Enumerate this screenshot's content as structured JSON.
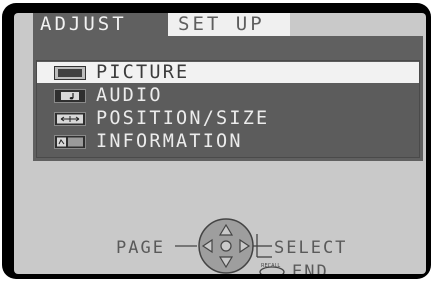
{
  "tabs": [
    {
      "label": "ADJUST",
      "active": true
    },
    {
      "label": "SET UP",
      "active": false
    }
  ],
  "menu": {
    "items": [
      {
        "label": "PICTURE",
        "icon": "picture-icon",
        "selected": true
      },
      {
        "label": "AUDIO",
        "icon": "audio-icon",
        "selected": false
      },
      {
        "label": "POSITION/SIZE",
        "icon": "position-size-icon",
        "selected": false
      },
      {
        "label": "INFORMATION",
        "icon": "information-icon",
        "selected": false
      }
    ]
  },
  "legend": {
    "page_label": "PAGE",
    "select_label": "SELECT",
    "recall_label": "RECALL",
    "end_label": "END"
  },
  "colors": {
    "frame": "#000000",
    "background": "#c9c9c9",
    "panel": "#606060",
    "selected_row": "#f2f2f2",
    "text_light": "#ececec",
    "text_dark": "#5a5a5a"
  }
}
